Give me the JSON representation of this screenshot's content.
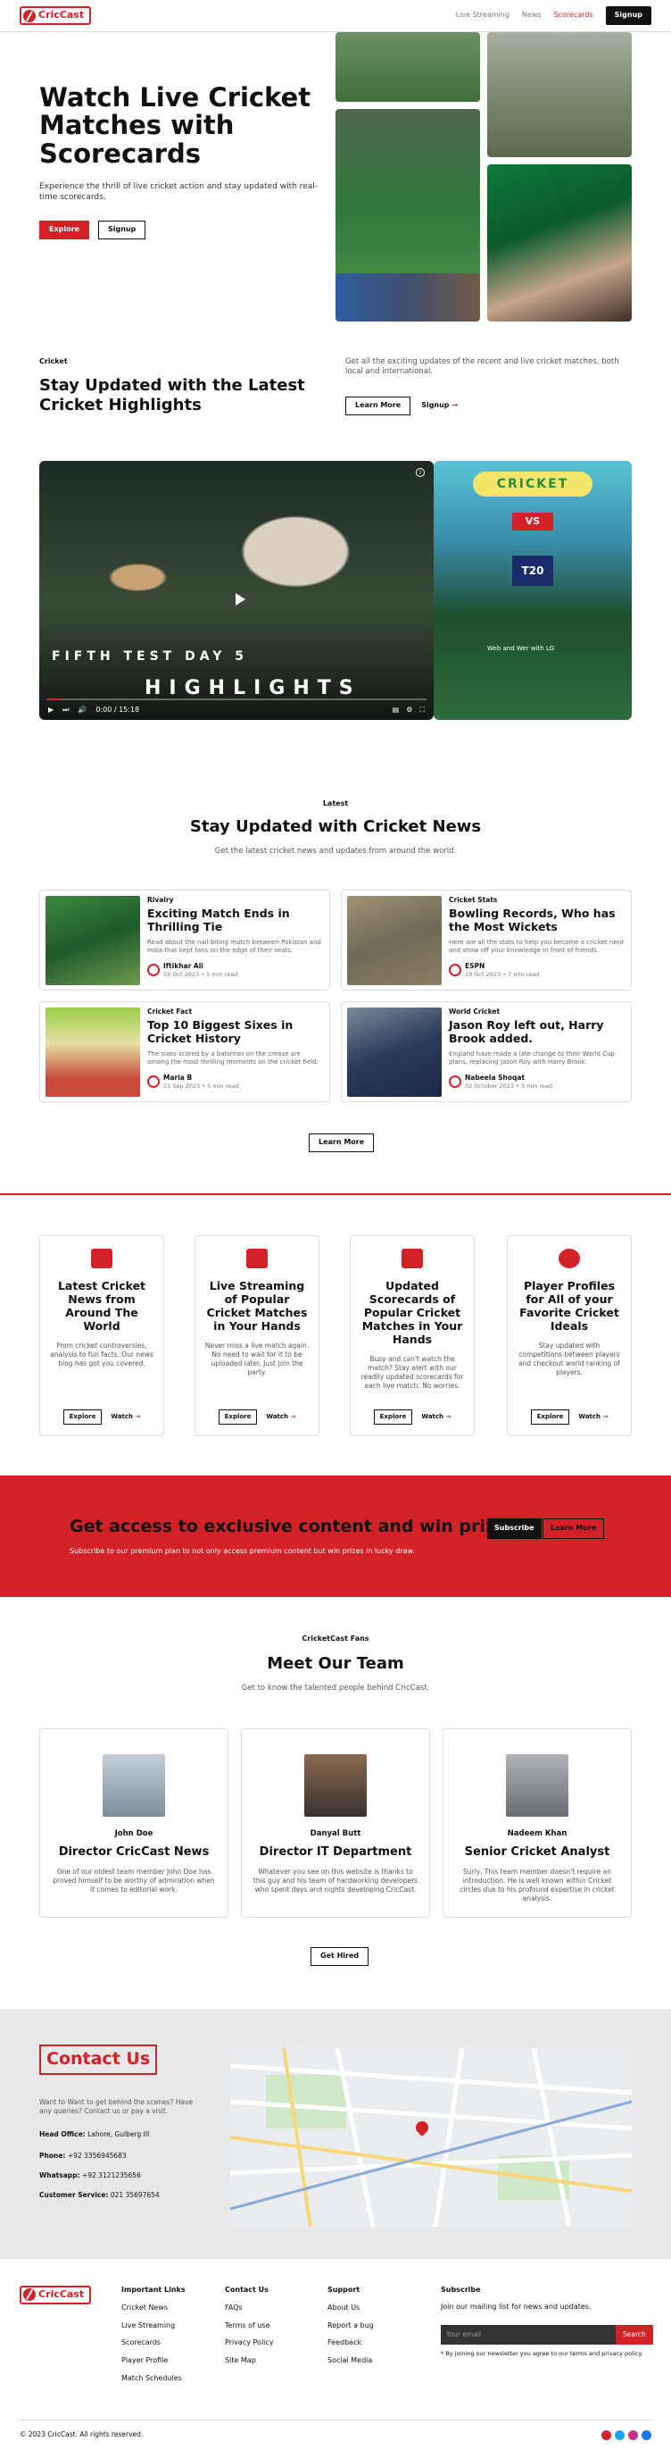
{
  "nav": {
    "brand": "CricCast",
    "items": [
      "Live Streaming",
      "News",
      "Scorecards"
    ],
    "signup": "Signup"
  },
  "hero": {
    "title": "Watch Live Cricket Matches with Scorecards",
    "text": "Experience the thrill of live cricket action and stay updated with real-time scorecards.",
    "explore": "Explore",
    "signup": "Signup"
  },
  "highlights": {
    "tag": "Cricket",
    "title": "Stay Updated with the Latest Cricket Highlights",
    "text": "Get all the exciting updates of the recent and live cricket matches, both local and international.",
    "learn": "Learn More",
    "signup": "Signup"
  },
  "video": {
    "line1": "FIFTH TEST DAY 5",
    "line2": "HIGHLIGHTS",
    "time": "0:00 / 15:18",
    "thumb_top": "CRICKET",
    "thumb_vs": "VS",
    "thumb_t20": "T20",
    "thumb_note": "Web and Wer with LG"
  },
  "news": {
    "tag": "Latest",
    "title": "Stay Updated with Cricket News",
    "sub": "Get the latest cricket news and updates from around the world.",
    "more": "Learn More",
    "cards": [
      {
        "cat": "Rivalry",
        "title": "Exciting Match Ends in Thrilling Tie",
        "desc": "Read about the nail-biting match between Pakistan and India that kept fans on the edge of their seats.",
        "author": "Iftikhar Ali",
        "meta": "03 Oct 2023 • 5 min read"
      },
      {
        "cat": "Cricket Stats",
        "title": "Bowling Records, Who has the Most Wickets",
        "desc": "Here are all the stats to help you become a cricket nerd and show off your knowledge in front of friends.",
        "author": "ESPN",
        "meta": "19 Oct 2023 • 7 min read"
      },
      {
        "cat": "Cricket Fact",
        "title": "Top 10 Biggest Sixes in Cricket History",
        "desc": "The sixes scored by a batsman on the crease are among the most thrilling moments on the cricket field.",
        "author": "Maria B",
        "meta": "21 Sep 2023 • 5 min read"
      },
      {
        "cat": "World Cricket",
        "title": "Jason Roy left out, Harry Brook added.",
        "desc": "England have made a late change to their World Cup plans, replacing Jason Roy with Harry Brook.",
        "author": "Nabeela Shoqat",
        "meta": "02 October 2023 • 3 min read"
      }
    ]
  },
  "features": [
    {
      "title": "Latest Cricket News from Around The World",
      "text": "From cricket controversies, analysis to fun facts. Our news blog has got you covered.",
      "btn": "Explore",
      "link": "Watch"
    },
    {
      "title": "Live Streaming of Popular Cricket Matches in Your Hands",
      "text": "Never miss a live match again. No need to wait for it to be uploaded later. Just join the party.",
      "btn": "Explore",
      "link": "Watch"
    },
    {
      "title": "Updated Scorecards of Popular Cricket Matches in Your Hands",
      "text": "Busy and can't watch the match? Stay alert with our readily updated scorecards for each live match. No worries.",
      "btn": "Explore",
      "link": "Watch"
    },
    {
      "title": "Player Profiles for All of your Favorite Cricket Ideals",
      "text": "Stay updated with competitions between players and checkout world ranking of players.",
      "btn": "Explore",
      "link": "Watch"
    }
  ],
  "cta": {
    "title": "Get access to exclusive content and win prizes.",
    "text": "Subscribe to our premium plan to not only access premium content but win prizes in lucky draw.",
    "subscribe": "Subscribe",
    "learn": "Learn More"
  },
  "team": {
    "tag": "CricketCast Fans",
    "title": "Meet Our Team",
    "sub": "Get to know the talented people behind CricCast.",
    "hire": "Get Hired",
    "members": [
      {
        "name": "John Doe",
        "role": "Director CricCast News",
        "bio": "One of our oldest team member John Doe has proved himself to be worthy of admiration when it comes to editorial work."
      },
      {
        "name": "Danyal Butt",
        "role": "Director IT Department",
        "bio": "Whatever you see on this website is thanks to this guy and his team of hardworking developers who spent days and nights developing CricCast."
      },
      {
        "name": "Nadeem Khan",
        "role": "Senior Cricket Analyst",
        "bio": "Surly, This team member doesn't require an introduction. He is well known within Cricket circles due to his profound expertise in cricket analysis."
      }
    ]
  },
  "contact": {
    "title": "Contact Us",
    "text": "Want to Want to get behind the scenes? Have any queries? Contact us or pay a visit.",
    "office_l": "Head Office:",
    "office": "Lahore, Gulberg III",
    "phone_l": "Phone:",
    "phone": "+92 3356945683",
    "wa_l": "Whatsapp:",
    "wa": "+92 3121235656",
    "cs_l": "Customer Service:",
    "cs": "021 35697654"
  },
  "footer": {
    "brand": "CricCast",
    "c1": "Important Links",
    "c1i": [
      "Cricket News",
      "Live Streaming",
      "Scorecards",
      "Player Profile",
      "Match Schedules"
    ],
    "c2": "Contact Us",
    "c2i": [
      "FAQs",
      "Terms of use",
      "Privacy Policy",
      "Site Map"
    ],
    "c3": "Support",
    "c3i": [
      "About Us",
      "Report a bug",
      "Feedback",
      "Social Media"
    ],
    "c4": "Subscribe",
    "c4t": "Join our mailing list for news and updates.",
    "email": "Your email",
    "search": "Search",
    "note": "* By joining our newsletter you agree to our terms and privacy policy.",
    "copy": "© 2023 CricCast. All rights reserved."
  },
  "colors": {
    "accent": "#d32128",
    "dark": "#111111"
  }
}
